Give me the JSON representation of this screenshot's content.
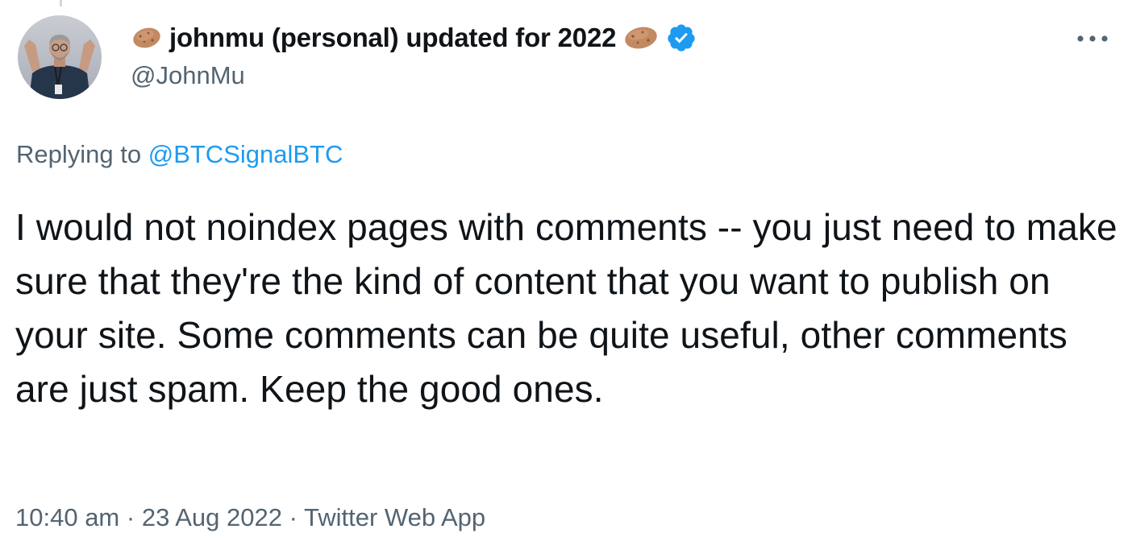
{
  "author": {
    "display_name": "johnmu (personal) updated for 2022",
    "handle": "@JohnMu",
    "name_emoji_left": "potato-emoji-icon",
    "name_emoji_right": "potato-emoji-icon",
    "verified": true,
    "verified_color": "#1d9bf0"
  },
  "reply": {
    "prefix": "Replying to",
    "mention": "@BTCSignalBTC"
  },
  "tweet": {
    "text": "I would not noindex pages with comments -- you just need to make sure that they're the kind of content that you want to publish on your site. Some comments can be quite useful, other comments are just spam. Keep the good ones."
  },
  "meta": {
    "time": "10:40 am",
    "separator": "·",
    "date": "23 Aug 2022",
    "source": "Twitter Web App"
  },
  "colors": {
    "text": "#0f1419",
    "secondary": "#536471",
    "link": "#1d9bf0"
  },
  "icons": {
    "more": "more-horizontal-icon",
    "verified": "verified-badge-icon"
  }
}
